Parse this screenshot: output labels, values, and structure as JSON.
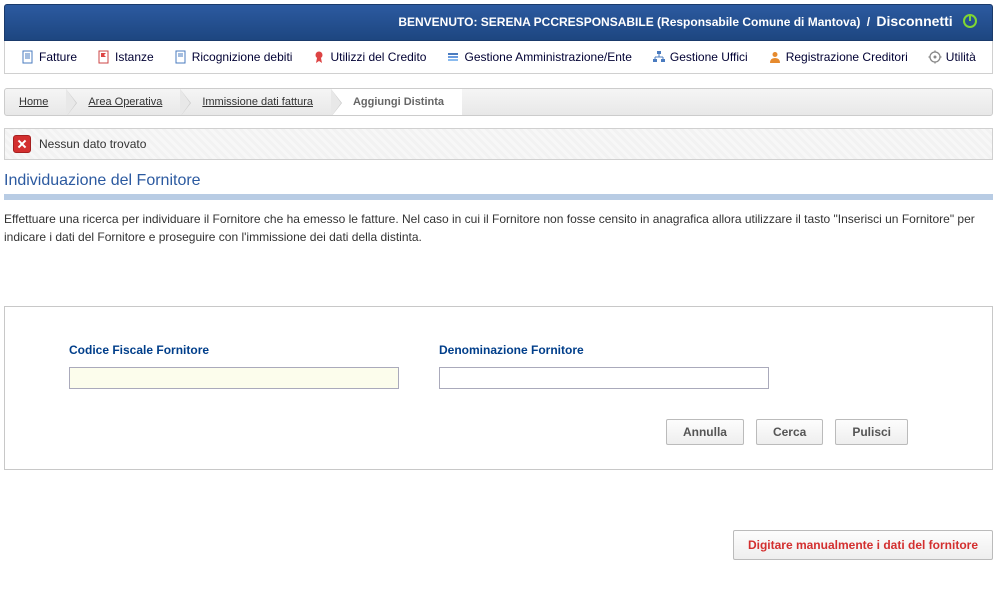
{
  "header": {
    "welcome": "BENVENUTO: SERENA PCCRESPONSABILE (Responsabile Comune di Mantova)",
    "slash": "/",
    "disconnect": "Disconnetti"
  },
  "menu": {
    "fatture": "Fatture",
    "istanze": "Istanze",
    "ricognizione": "Ricognizione debiti",
    "utilizzi": "Utilizzi del Credito",
    "gest_amm": "Gestione Amministrazione/Ente",
    "gest_uff": "Gestione Uffici",
    "reg_cred": "Registrazione Creditori",
    "utilita": "Utilità"
  },
  "breadcrumb": {
    "home": "Home",
    "area": "Area Operativa",
    "immissione": "Immissione dati fattura",
    "current": "Aggiungi Distinta"
  },
  "message": {
    "text": "Nessun dato trovato"
  },
  "section": {
    "title": "Individuazione del Fornitore",
    "description": "Effettuare una ricerca per individuare il Fornitore che ha emesso le fatture. Nel caso in cui il Fornitore non fosse censito in anagrafica allora utilizzare il tasto \"Inserisci un Fornitore\" per indicare i dati del Fornitore e proseguire con l'immissione dei dati della distinta."
  },
  "form": {
    "cf_label": "Codice Fiscale Fornitore",
    "cf_value": "",
    "den_label": "Denominazione Fornitore",
    "den_value": "",
    "annulla": "Annulla",
    "cerca": "Cerca",
    "pulisci": "Pulisci"
  },
  "footer": {
    "manual": "Digitare manualmente i dati del fornitore"
  }
}
